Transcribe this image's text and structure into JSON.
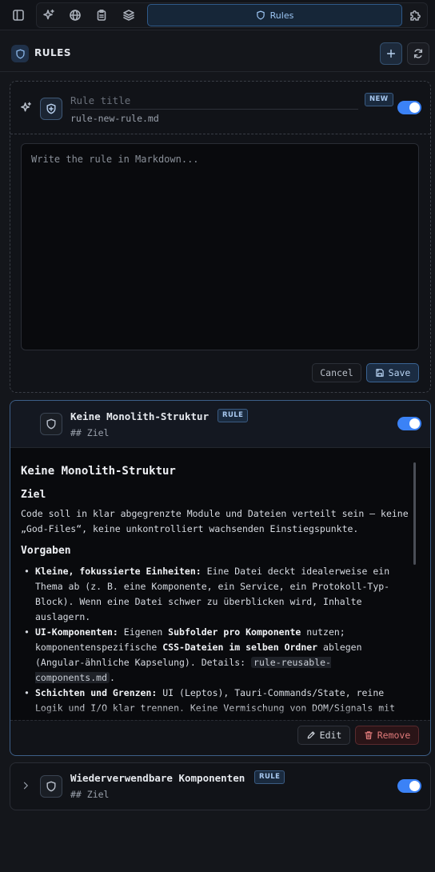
{
  "toolbar": {
    "active_tab_label": "Rules",
    "icons": [
      "sidebar-toggle-icon",
      "sparkle-icon",
      "globe-icon",
      "clipboard-icon",
      "layers-icon",
      "shield-icon",
      "puzzle-icon"
    ]
  },
  "header": {
    "title": "RULES",
    "icons": [
      "shield-icon",
      "plus-icon",
      "refresh-icon"
    ]
  },
  "new_rule": {
    "title_placeholder": "Rule title",
    "title_value": "",
    "filename": "rule-new-rule.md",
    "badge": "NEW",
    "enabled": true,
    "body_placeholder": "Write the rule in Markdown...",
    "body_value": "",
    "cancel_label": "Cancel",
    "save_label": "Save"
  },
  "rules": [
    {
      "name": "Keine Monolith-Struktur",
      "badge": "RULE",
      "subtitle": "## Ziel",
      "enabled": true,
      "expanded": true,
      "content": {
        "h1": "Keine Monolith-Struktur",
        "h2_goal": "Ziel",
        "goal_text": "Code soll in klar abgegrenzte Module und Dateien verteilt sein — keine „God-Files“, keine unkontrolliert wachsenden Einstiegspunkte.",
        "h2_rules": "Vorgaben",
        "items": [
          {
            "strong": "Kleine, fokussierte Einheiten:",
            "text": " Eine Datei deckt idealerweise ein Thema ab (z. B. eine Komponente, ein Service, ein Protokoll-Typ-Block). Wenn eine Datei schwer zu überblicken wird, Inhalte auslagern."
          },
          {
            "strong": "UI-Komponenten:",
            "text_a": " Eigenen ",
            "strong_b": "Subfolder pro Komponente",
            "text_b": " nutzen; komponentenspezifische ",
            "strong_c": "CSS-Dateien im selben Ordner",
            "text_c": " ablegen (Angular-ähnliche Kapselung). Details: ",
            "code": "rule-reusable-components.md",
            "text_d": "."
          },
          {
            "strong": "Schichten und Grenzen:",
            "text": " UI (Leptos), Tauri-Commands/State, reine Logik und I/O klar trennen. Keine Vermischung von DOM/Signals mit"
          }
        ]
      },
      "edit_label": "Edit",
      "remove_label": "Remove"
    },
    {
      "name": "Wiederverwendbare Komponenten",
      "badge": "RULE",
      "subtitle": "## Ziel",
      "enabled": true,
      "expanded": false
    }
  ],
  "colors": {
    "accent": "#3b82f6",
    "danger": "#e05555",
    "background": "#14161b"
  }
}
